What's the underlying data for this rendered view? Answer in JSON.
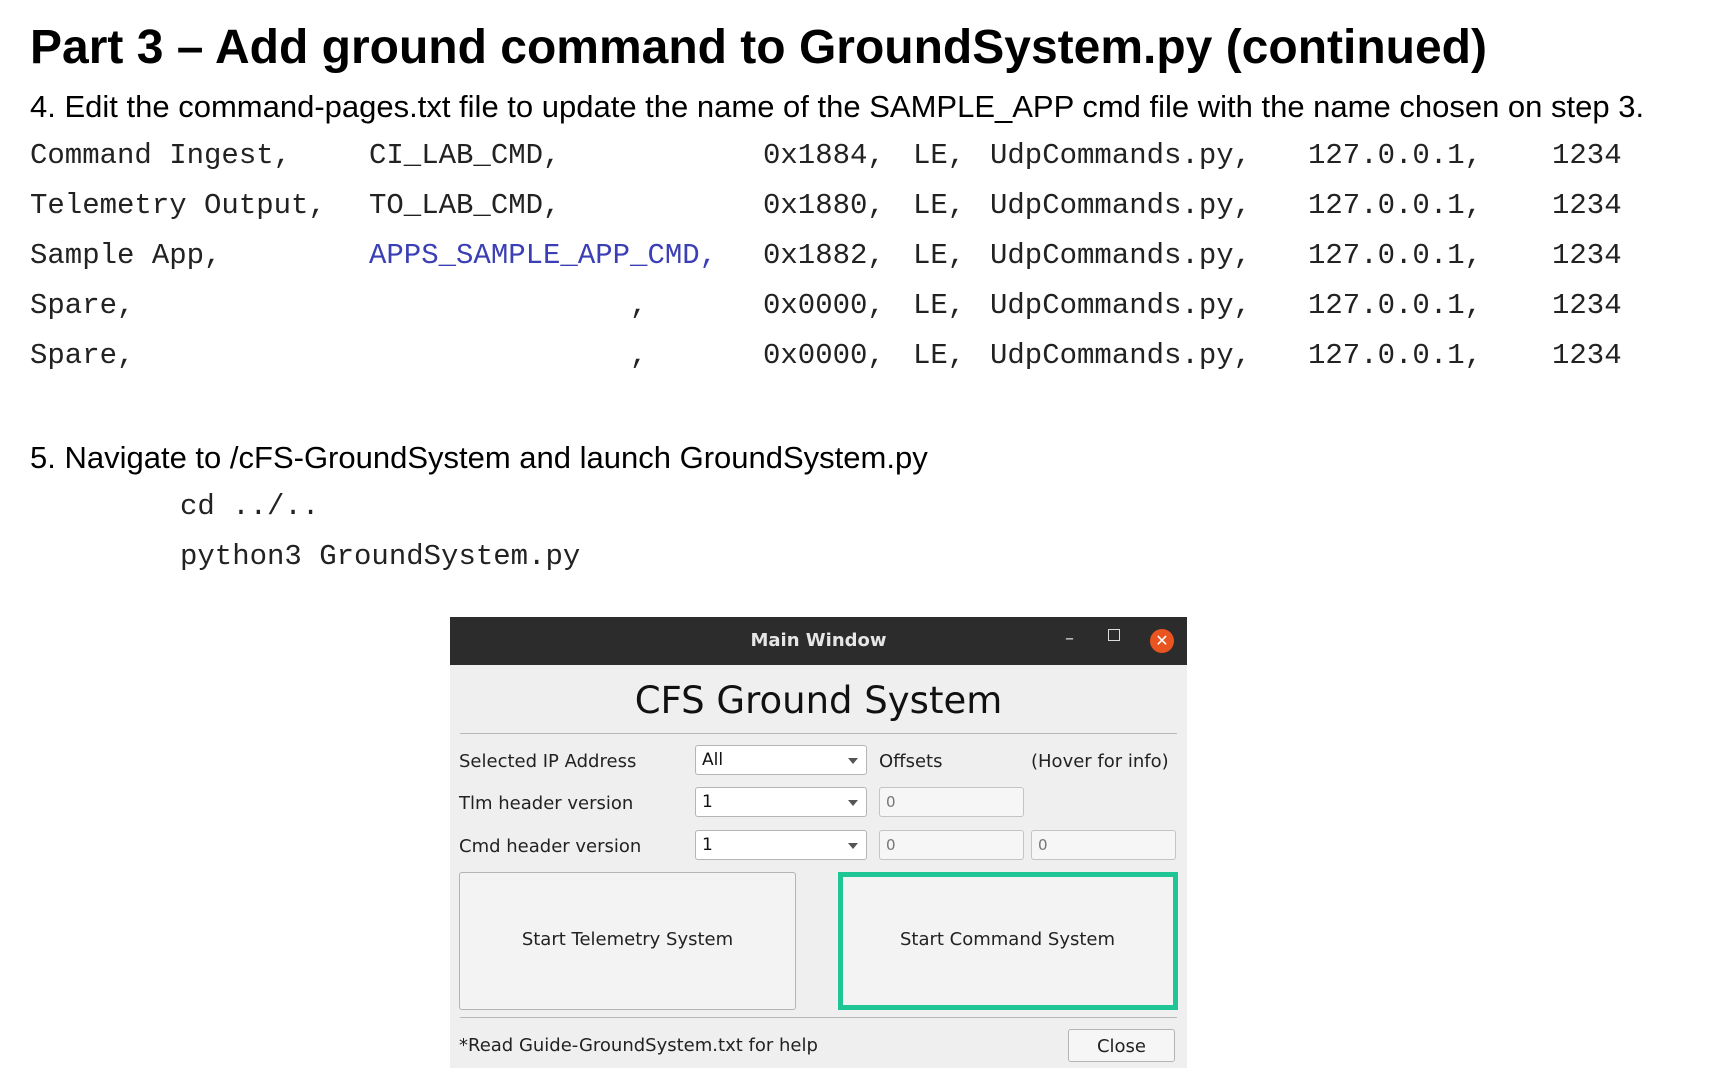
{
  "heading": "Part 3 – Add ground command to GroundSystem.py (continued)",
  "step4": "4. Edit the command-pages.txt file to update the name of the SAMPLE_APP cmd file with the name chosen on step 3.",
  "command_pages": [
    {
      "name": "Command Ingest,",
      "macro": "CI_LAB_CMD,",
      "id": "0x1884,",
      "endian": "LE,",
      "file": "UdpCommands.py,",
      "ip": "127.0.0.1,",
      "port": "1234"
    },
    {
      "name": "Telemetry Output,",
      "macro": "TO_LAB_CMD,",
      "id": "0x1880,",
      "endian": "LE,",
      "file": "UdpCommands.py,",
      "ip": "127.0.0.1,",
      "port": "1234"
    },
    {
      "name": "Sample App,",
      "macro": "APPS_SAMPLE_APP_CMD,",
      "id": "0x1882,",
      "endian": "LE,",
      "file": "UdpCommands.py,",
      "ip": "127.0.0.1,",
      "port": "1234"
    },
    {
      "name": "Spare,",
      "macro": ",",
      "id": "0x0000,",
      "endian": "LE,",
      "file": "UdpCommands.py,",
      "ip": "127.0.0.1,",
      "port": "1234"
    },
    {
      "name": "Spare,",
      "macro": ",",
      "id": "0x0000,",
      "endian": "LE,",
      "file": "UdpCommands.py,",
      "ip": "127.0.0.1,",
      "port": "1234"
    }
  ],
  "step5": "5. Navigate to /cFS-GroundSystem and launch GroundSystem.py",
  "code": [
    "cd ../..",
    "python3 GroundSystem.py"
  ],
  "window": {
    "title": "Main Window",
    "min_glyph": "–",
    "close_glyph": "✕",
    "app_title": "CFS Ground System",
    "labels": {
      "ip": "Selected IP Address",
      "tlm": "Tlm header version",
      "cmd": "Cmd header version",
      "offsets": "Offsets",
      "hover": "(Hover for info)"
    },
    "combos": {
      "ip": "All",
      "tlm": "1",
      "cmd": "1"
    },
    "offset_fields": {
      "tlm": "0",
      "cmd_a": "0",
      "cmd_b": "0"
    },
    "buttons": {
      "telemetry": "Start Telemetry System",
      "command": "Start Command System",
      "close": "Close"
    },
    "help": "*Read Guide-GroundSystem.txt for help",
    "highlight_color": "#1fc695",
    "title_bar_color": "#2c2c2c",
    "close_button_color": "#e95420"
  },
  "colors": {
    "highlighted_macro": "#3b3fb5"
  }
}
